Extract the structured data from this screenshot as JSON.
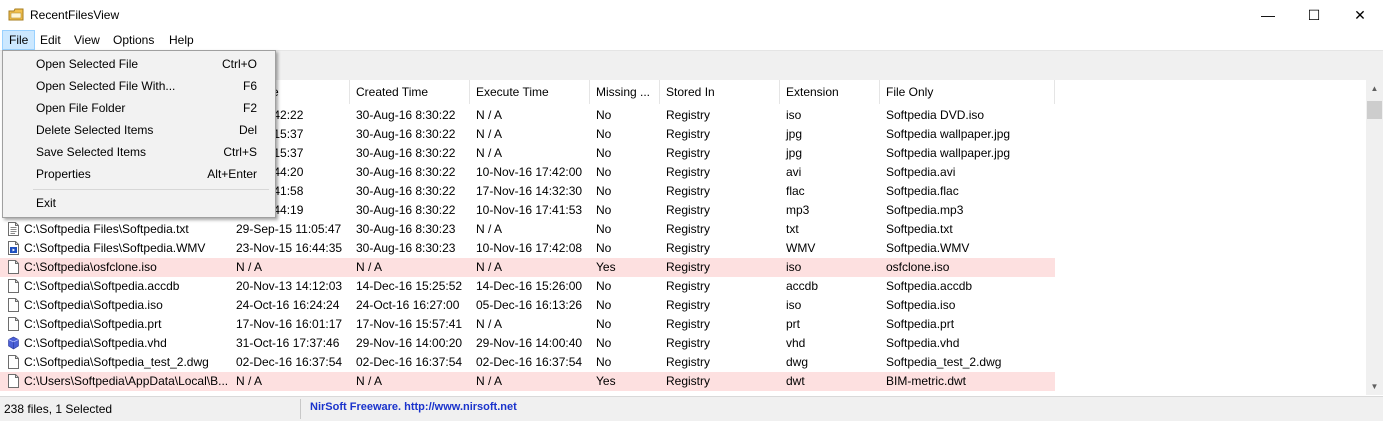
{
  "window": {
    "title": "RecentFilesView",
    "minimize": "—",
    "maximize": "☐",
    "close": "✕"
  },
  "menubar": [
    "File",
    "Edit",
    "View",
    "Options",
    "Help"
  ],
  "file_menu": {
    "items": [
      {
        "label": "Open Selected File",
        "shortcut": "Ctrl+O"
      },
      {
        "label": "Open Selected File With...",
        "shortcut": "F6"
      },
      {
        "label": "Open File Folder",
        "shortcut": "F2"
      },
      {
        "label": "Delete Selected Items",
        "shortcut": "Del"
      },
      {
        "label": "Save Selected Items",
        "shortcut": "Ctrl+S"
      },
      {
        "label": "Properties",
        "shortcut": "Alt+Enter"
      }
    ],
    "exit": "Exit"
  },
  "columns": [
    "ed Time",
    "Created Time",
    "Execute Time",
    "Missing ...",
    "Stored In",
    "Extension",
    "File Only"
  ],
  "rows": [
    {
      "icon": "none",
      "filename": "",
      "modified": "-14 13:42:22",
      "created": "30-Aug-16 8:30:22",
      "execute": "N / A",
      "missing": "No",
      "stored": "Registry",
      "ext": "iso",
      "fileonly": "Softpedia DVD.iso"
    },
    {
      "icon": "none",
      "filename": "",
      "modified": "-14 10:15:37",
      "created": "30-Aug-16 8:30:22",
      "execute": "N / A",
      "missing": "No",
      "stored": "Registry",
      "ext": "jpg",
      "fileonly": "Softpedia wallpaper.jpg"
    },
    {
      "icon": "none",
      "filename": "",
      "modified": "-14 10:15:37",
      "created": "30-Aug-16 8:30:22",
      "execute": "N / A",
      "missing": "No",
      "stored": "Registry",
      "ext": "jpg",
      "fileonly": "Softpedia wallpaper.jpg"
    },
    {
      "icon": "none",
      "filename": "",
      "modified": "-14 13:44:20",
      "created": "30-Aug-16 8:30:22",
      "execute": "10-Nov-16 17:42:00",
      "missing": "No",
      "stored": "Registry",
      "ext": "avi",
      "fileonly": "Softpedia.avi"
    },
    {
      "icon": "none",
      "filename": "",
      "modified": "-14 13:41:58",
      "created": "30-Aug-16 8:30:22",
      "execute": "17-Nov-16 14:32:30",
      "missing": "No",
      "stored": "Registry",
      "ext": "flac",
      "fileonly": "Softpedia.flac"
    },
    {
      "icon": "none",
      "filename": "",
      "modified": "-14 13:44:19",
      "created": "30-Aug-16 8:30:22",
      "execute": "10-Nov-16 17:41:53",
      "missing": "No",
      "stored": "Registry",
      "ext": "mp3",
      "fileonly": "Softpedia.mp3"
    },
    {
      "icon": "text-file",
      "filename": "C:\\Softpedia Files\\Softpedia.txt",
      "modified": "29-Sep-15 11:05:47",
      "created": "30-Aug-16 8:30:23",
      "execute": "N / A",
      "missing": "No",
      "stored": "Registry",
      "ext": "txt",
      "fileonly": "Softpedia.txt"
    },
    {
      "icon": "video-file",
      "filename": "C:\\Softpedia Files\\Softpedia.WMV",
      "modified": "23-Nov-15 16:44:35",
      "created": "30-Aug-16 8:30:23",
      "execute": "10-Nov-16 17:42:08",
      "missing": "No",
      "stored": "Registry",
      "ext": "WMV",
      "fileonly": "Softpedia.WMV"
    },
    {
      "icon": "blank-file",
      "filename": "C:\\Softpedia\\osfclone.iso",
      "modified": "N / A",
      "created": "N / A",
      "execute": "N / A",
      "missing": "Yes",
      "stored": "Registry",
      "ext": "iso",
      "fileonly": "osfclone.iso"
    },
    {
      "icon": "blank-file",
      "filename": "C:\\Softpedia\\Softpedia.accdb",
      "modified": "20-Nov-13 14:12:03",
      "created": "14-Dec-16 15:25:52",
      "execute": "14-Dec-16 15:26:00",
      "missing": "No",
      "stored": "Registry",
      "ext": "accdb",
      "fileonly": "Softpedia.accdb"
    },
    {
      "icon": "blank-file",
      "filename": "C:\\Softpedia\\Softpedia.iso",
      "modified": "24-Oct-16 16:24:24",
      "created": "24-Oct-16 16:27:00",
      "execute": "05-Dec-16 16:13:26",
      "missing": "No",
      "stored": "Registry",
      "ext": "iso",
      "fileonly": "Softpedia.iso"
    },
    {
      "icon": "blank-file",
      "filename": "C:\\Softpedia\\Softpedia.prt",
      "modified": "17-Nov-16 16:01:17",
      "created": "17-Nov-16 15:57:41",
      "execute": "N / A",
      "missing": "No",
      "stored": "Registry",
      "ext": "prt",
      "fileonly": "Softpedia.prt"
    },
    {
      "icon": "vhd-file",
      "filename": "C:\\Softpedia\\Softpedia.vhd",
      "modified": "31-Oct-16 17:37:46",
      "created": "29-Nov-16 14:00:20",
      "execute": "29-Nov-16 14:00:40",
      "missing": "No",
      "stored": "Registry",
      "ext": "vhd",
      "fileonly": "Softpedia.vhd"
    },
    {
      "icon": "blank-file",
      "filename": "C:\\Softpedia\\Softpedia_test_2.dwg",
      "modified": "02-Dec-16 16:37:54",
      "created": "02-Dec-16 16:37:54",
      "execute": "02-Dec-16 16:37:54",
      "missing": "No",
      "stored": "Registry",
      "ext": "dwg",
      "fileonly": "Softpedia_test_2.dwg"
    },
    {
      "icon": "blank-file",
      "filename": "C:\\Users\\Softpedia\\AppData\\Local\\B...",
      "modified": "N / A",
      "created": "N / A",
      "execute": "N / A",
      "missing": "Yes",
      "stored": "Registry",
      "ext": "dwt",
      "fileonly": "BIM-metric.dwt"
    }
  ],
  "status": {
    "count": "238 files, 1 Selected",
    "link": "NirSoft Freeware.  http://www.nirsoft.net"
  }
}
